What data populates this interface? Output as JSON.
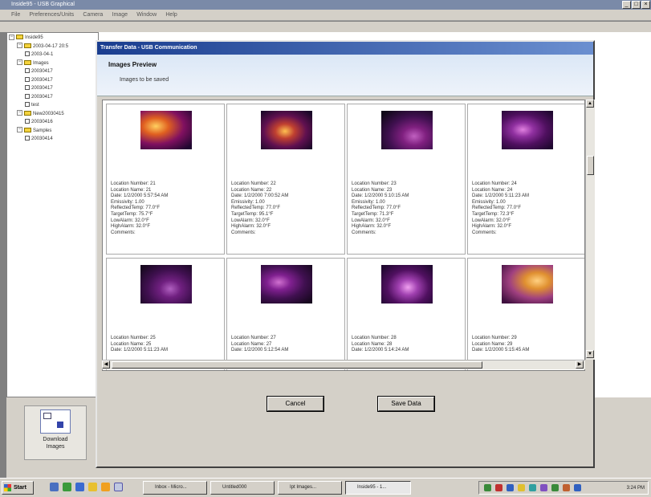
{
  "app": {
    "title": "Inside95 - USB Graphical",
    "menu": [
      "File",
      "Preferences/Units",
      "Camera",
      "Image",
      "Window",
      "Help"
    ]
  },
  "tree": [
    {
      "label": "Inside95",
      "level": 0,
      "type": "root"
    },
    {
      "label": "2003-04-17 20:5",
      "level": 1,
      "type": "folder"
    },
    {
      "label": "2003-04-1",
      "level": 2,
      "type": "image"
    },
    {
      "label": "Images",
      "level": 1,
      "type": "folder"
    },
    {
      "label": "20030417",
      "level": 2,
      "type": "image"
    },
    {
      "label": "20030417",
      "level": 2,
      "type": "image"
    },
    {
      "label": "20030417",
      "level": 2,
      "type": "image"
    },
    {
      "label": "20030417",
      "level": 2,
      "type": "image"
    },
    {
      "label": "test",
      "level": 2,
      "type": "image"
    },
    {
      "label": "New20030415",
      "level": 1,
      "type": "folder"
    },
    {
      "label": "20030416",
      "level": 2,
      "type": "image"
    },
    {
      "label": "Samples",
      "level": 1,
      "type": "folder"
    },
    {
      "label": "20030414",
      "level": 2,
      "type": "image"
    }
  ],
  "download": {
    "label_line1": "Download",
    "label_line2": "Images"
  },
  "dialog": {
    "title": "Transfer Data - USB Communication",
    "header": "Images Preview",
    "subheader": "Images to be saved",
    "cancel_label": "Cancel",
    "save_label": "Save Data"
  },
  "images": [
    {
      "lines": [
        "Location Number: 21",
        "Location Name: 21",
        "Date: 1/2/2000 5:57:54 AM",
        "Emissivity: 1.00",
        "ReflectedTemp: 77.0°F",
        "TargetTemp: 75.7°F",
        "LowAlarm: 32.0°F",
        "HighAlarm: 32.0°F",
        "Comments:"
      ],
      "palette": [
        "#ffd060",
        "#e06020",
        "#801060",
        "#200830"
      ]
    },
    {
      "lines": [
        "Location Number: 22",
        "Location Name: 22",
        "Date: 1/2/2000 7:00:52 AM",
        "Emissivity: 1.00",
        "ReflectedTemp: 77.0°F",
        "TargetTemp: 95.1°F",
        "LowAlarm: 32.0°F",
        "HighAlarm: 32.0°F",
        "Comments:"
      ],
      "palette": [
        "#ffc050",
        "#c04030",
        "#601050",
        "#1a0828"
      ]
    },
    {
      "lines": [
        "Location Number: 23",
        "Location Name: 23",
        "Date: 1/2/2000 5:10:15 AM",
        "Emissivity: 1.00",
        "ReflectedTemp: 77.0°F",
        "TargetTemp: 71.3°F",
        "LowAlarm: 32.0°F",
        "HighAlarm: 32.0°F",
        "Comments:"
      ],
      "palette": [
        "#c060c0",
        "#802080",
        "#401050",
        "#100818"
      ]
    },
    {
      "lines": [
        "Location Number: 24",
        "Location Name: 24",
        "Date: 1/2/2000 5:11:23 AM",
        "Emissivity: 1.00",
        "ReflectedTemp: 77.0°F",
        "TargetTemp: 72.3°F",
        "LowAlarm: 32.0°F",
        "HighAlarm: 32.0°F",
        "Comments:"
      ],
      "palette": [
        "#e080e0",
        "#9030a0",
        "#501060",
        "#200830"
      ]
    },
    {
      "lines": [
        "Location Number: 25",
        "Location Name: 25",
        "Date: 1/2/2000 5:11:23 AM"
      ],
      "palette": [
        "#b060c0",
        "#702080",
        "#401050",
        "#180820"
      ]
    },
    {
      "lines": [
        "Location Number: 27",
        "Location Name: 27",
        "Date: 1/2/2000 5:12:54 AM"
      ],
      "palette": [
        "#d070d0",
        "#802090",
        "#401050",
        "#180820"
      ]
    },
    {
      "lines": [
        "Location Number: 28",
        "Location Name: 28",
        "Date: 1/2/2000 5:14:24 AM"
      ],
      "palette": [
        "#f0a0f0",
        "#a040b0",
        "#501060",
        "#200830"
      ]
    },
    {
      "lines": [
        "Location Number: 29",
        "Location Name: 29",
        "Date: 1/2/2000 5:15:45 AM"
      ],
      "palette": [
        "#ffd080",
        "#e09030",
        "#a04080",
        "#401040"
      ]
    }
  ],
  "taskbar": {
    "start_label": "Start",
    "tasks": [
      "Inbox - Micro...",
      "Untitled000",
      "Ipt Images...",
      "Inside95 - 1..."
    ],
    "clock": "3:24 PM"
  }
}
